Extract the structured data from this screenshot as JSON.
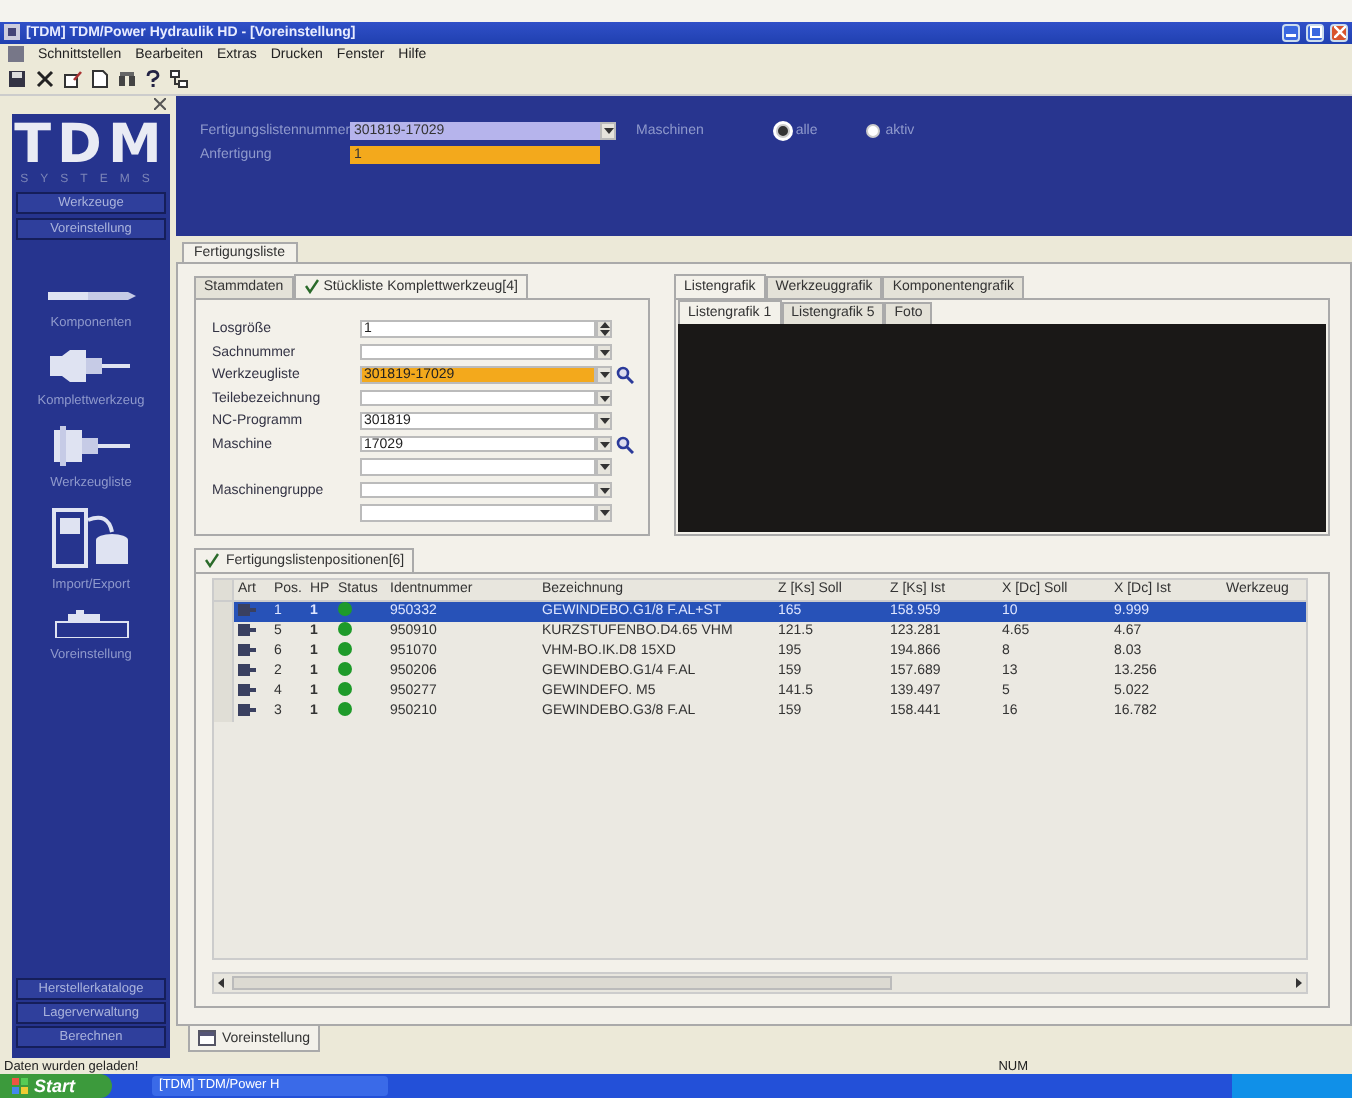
{
  "window": {
    "title": "[TDM] TDM/Power Hydraulik HD - [Voreinstellung]"
  },
  "menu": [
    "Schnittstellen",
    "Bearbeiten",
    "Extras",
    "Drucken",
    "Fenster",
    "Hilfe"
  ],
  "sidebar": {
    "logo": "TDM",
    "logo_subtitle": "SYSTEMS",
    "top_buttons": [
      "Werkzeuge",
      "Voreinstellung"
    ],
    "items": [
      {
        "kind": "drill",
        "label": "Komponenten"
      },
      {
        "kind": "holder",
        "label": "Komplettwerkzeug"
      },
      {
        "kind": "spindle",
        "label": "Werkzeugliste"
      },
      {
        "kind": "import",
        "label": "Import/Export"
      },
      {
        "kind": "machine",
        "label": "Voreinstellung"
      }
    ],
    "bottom_buttons": [
      "Herstellerkataloge",
      "Lagerverwaltung",
      "Berechnen"
    ]
  },
  "header": {
    "fields": [
      {
        "label": "Fertigungslistennummer",
        "value": "301819-17029",
        "kind": "dropdown"
      },
      {
        "label": "Anfertigung",
        "value": "1",
        "kind": "highlight"
      }
    ],
    "radio_label": "Maschinen",
    "radios": [
      {
        "label": "alle",
        "selected": true
      },
      {
        "label": "aktiv",
        "selected": false
      }
    ]
  },
  "main_tab": "Fertigungsliste",
  "form_tabs": [
    {
      "label": "Stammdaten",
      "checked": false,
      "selected": false
    },
    {
      "label": "Stückliste Komplettwerkzeug[4]",
      "checked": true,
      "selected": true
    }
  ],
  "form": [
    {
      "label": "Losgröße",
      "value": "1",
      "kind": "spin"
    },
    {
      "label": "Sachnummer",
      "kind": "dropdown"
    },
    {
      "label": "Werkzeugliste",
      "value": "301819-17029",
      "kind": "highlight-search"
    },
    {
      "label": "Teilebezeichnung",
      "kind": "dropdown"
    },
    {
      "label": "NC-Programm",
      "value": "301819",
      "kind": "dropdown"
    },
    {
      "label": "Maschine",
      "value": "17029",
      "kind": "search"
    },
    {
      "kind": "dropdown"
    },
    {
      "label": "Maschinengruppe",
      "kind": "dropdown"
    },
    {
      "kind": "dropdown"
    }
  ],
  "graphic_tabs": [
    {
      "label": "Listengrafik",
      "selected": true
    },
    {
      "label": "Werkzeuggrafik",
      "selected": false
    },
    {
      "label": "Komponentengrafik",
      "selected": false
    }
  ],
  "graphic_subtabs": [
    {
      "label": "Listengrafik 1",
      "selected": true
    },
    {
      "label": "Listengrafik 5",
      "selected": false
    },
    {
      "label": "Foto",
      "selected": false
    }
  ],
  "table": {
    "tab": "Fertigungslistenpositionen[6]",
    "tab_checked": true,
    "columns": [
      {
        "label": "Art",
        "kind": "icon"
      },
      {
        "label": "Pos.",
        "kind": "text"
      },
      {
        "label": "HP",
        "kind": "bold"
      },
      {
        "label": "Status",
        "kind": "status"
      },
      {
        "label": "Identnummer",
        "kind": "text"
      },
      {
        "label": "Bezeichnung",
        "kind": "text"
      },
      {
        "label": "Z [Ks] Soll",
        "kind": "text"
      },
      {
        "label": "Z [Ks] Ist",
        "kind": "text"
      },
      {
        "label": "X [Dc] Soll",
        "kind": "text"
      },
      {
        "label": "X [Dc] Ist",
        "kind": "text"
      },
      {
        "label": "Werkzeug",
        "kind": "text"
      }
    ],
    "rows": [
      {
        "selected": true,
        "color": "#1e9a2a",
        "cells": [
          "",
          "1",
          "1",
          "",
          "950332",
          "GEWINDEBO.G1/8 F.AL+ST",
          "165",
          "158.959",
          "10",
          "9.999"
        ]
      },
      {
        "selected": false,
        "color": "#1e9a2a",
        "cells": [
          "",
          "5",
          "1",
          "",
          "950910",
          "KURZSTUFENBO.D4.65 VHM",
          "121.5",
          "123.281",
          "4.65",
          "4.67"
        ]
      },
      {
        "selected": false,
        "color": "#1e9a2a",
        "cells": [
          "",
          "6",
          "1",
          "",
          "951070",
          "VHM-BO.IK.D8 15XD",
          "195",
          "194.866",
          "8",
          "8.03"
        ]
      },
      {
        "selected": false,
        "color": "#1e9a2a",
        "cells": [
          "",
          "2",
          "1",
          "",
          "950206",
          "GEWINDEBO.G1/4 F.AL",
          "159",
          "157.689",
          "13",
          "13.256"
        ]
      },
      {
        "selected": false,
        "color": "#1e9a2a",
        "cells": [
          "",
          "4",
          "1",
          "",
          "950277",
          "GEWINDEFO. M5",
          "141.5",
          "139.497",
          "5",
          "5.022"
        ]
      },
      {
        "selected": false,
        "color": "#1e9a2a",
        "cells": [
          "",
          "3",
          "1",
          "",
          "950210",
          "GEWINDEBO.G3/8 F.AL",
          "159",
          "158.441",
          "16",
          "16.782"
        ]
      }
    ]
  },
  "bottom_tab": "Voreinstellung",
  "status": {
    "message": "Daten wurden geladen!",
    "indicator": "NUM"
  },
  "taskbar": {
    "start": "Start",
    "task": "[TDM] TDM/Power H"
  }
}
